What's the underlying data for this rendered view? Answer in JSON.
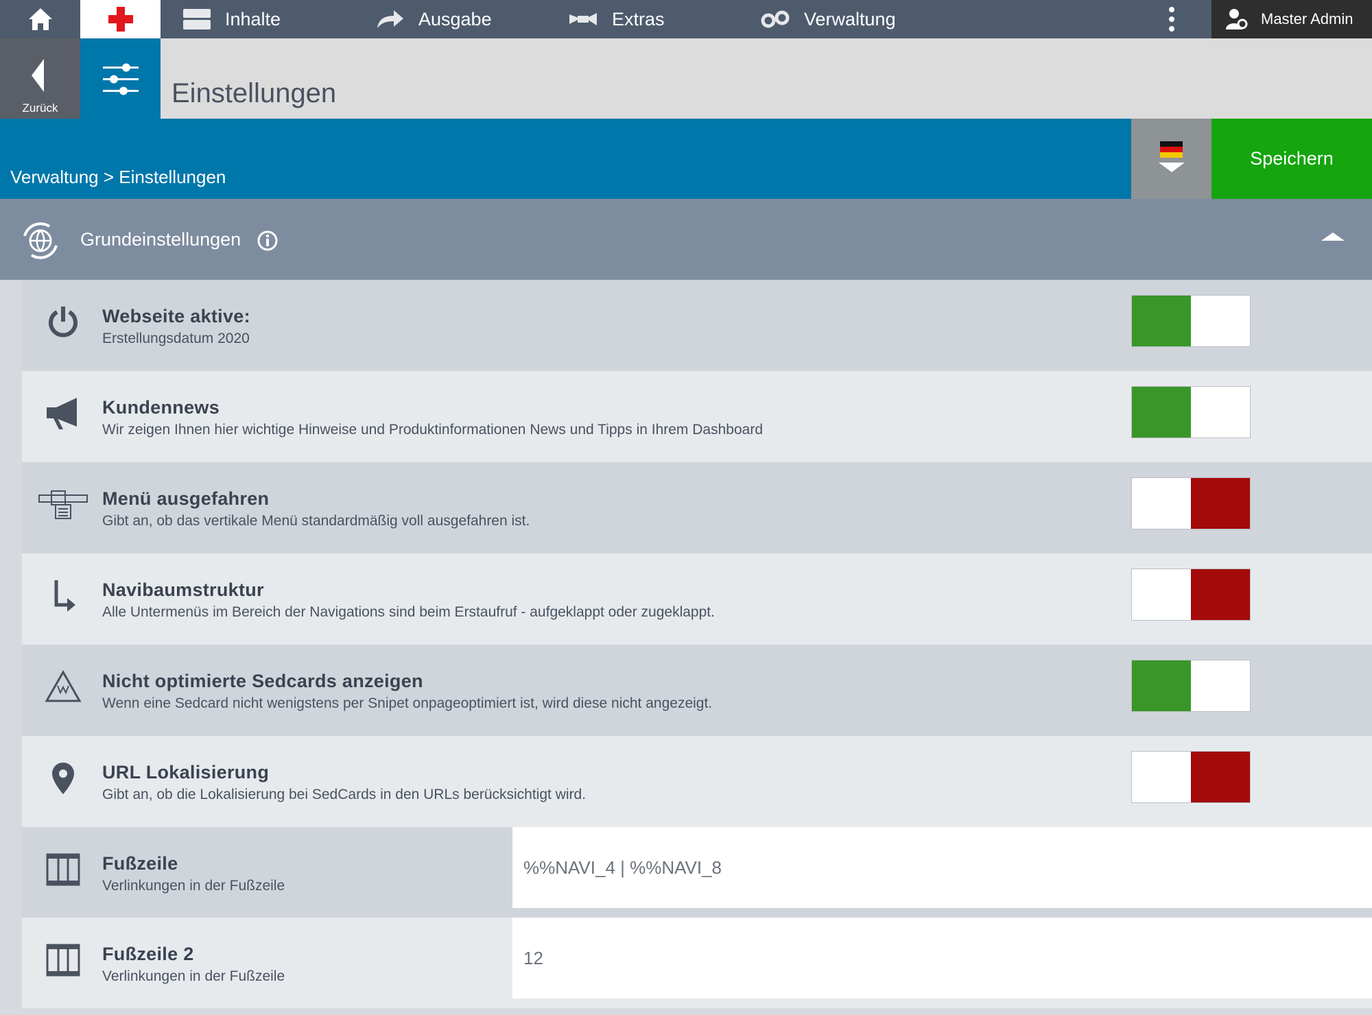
{
  "nav": {
    "items": [
      {
        "label": "Inhalte",
        "icon": "content-icon"
      },
      {
        "label": "Ausgabe",
        "icon": "output-arrow-icon"
      },
      {
        "label": "Extras",
        "icon": "extras-icon"
      },
      {
        "label": "Verwaltung",
        "icon": "gears-icon"
      }
    ],
    "user": "Master Admin"
  },
  "header": {
    "back_label": "Zurück",
    "title": "Einstellungen"
  },
  "breadcrumb": "Verwaltung > Einstellungen",
  "save_label": "Speichern",
  "section": {
    "title": "Grundeinstellungen"
  },
  "settings": [
    {
      "title": "Webseite aktive:",
      "desc": "Erstellungsdatum 2020",
      "type": "toggle",
      "on": true,
      "icon": "power-icon"
    },
    {
      "title": "Kundennews",
      "desc": "Wir zeigen Ihnen hier wichtige Hinweise und Produktinformationen News und Tipps in Ihrem Dashboard",
      "type": "toggle",
      "on": true,
      "icon": "megaphone-icon"
    },
    {
      "title": "Menü ausgefahren",
      "desc": "Gibt an, ob das vertikale Menü standardmäßig voll ausgefahren ist.",
      "type": "toggle",
      "on": false,
      "icon": "menu-tree-icon"
    },
    {
      "title": "Navibaumstruktur",
      "desc": "Alle Untermenüs im Bereich der Navigations sind beim Erstaufruf - aufgeklappt oder zugeklappt.",
      "type": "toggle",
      "on": false,
      "icon": "arrow-down-right-icon"
    },
    {
      "title": "Nicht optimierte Sedcards anzeigen",
      "desc": "Wenn eine Sedcard nicht wenigstens per Snipet onpageoptimiert ist, wird diese nicht angezeigt.",
      "type": "toggle",
      "on": true,
      "icon": "recycle-icon"
    },
    {
      "title": "URL Lokalisierung",
      "desc": "Gibt an, ob die Lokalisierung bei SedCards in den URLs berücksichtigt wird.",
      "type": "toggle",
      "on": false,
      "icon": "map-pin-icon"
    },
    {
      "title": "Fußzeile",
      "desc": "Verlinkungen in der Fußzeile",
      "type": "input",
      "value": "%%NAVI_4 | %%NAVI_8",
      "icon": "columns-icon"
    },
    {
      "title": "Fußzeile 2",
      "desc": "Verlinkungen in der Fußzeile",
      "type": "input",
      "value": "12",
      "icon": "columns-icon"
    }
  ],
  "colors": {
    "on": "#3a9628",
    "off": "#a40a0a",
    "save": "#15a50f",
    "blue": "#0077aa"
  }
}
